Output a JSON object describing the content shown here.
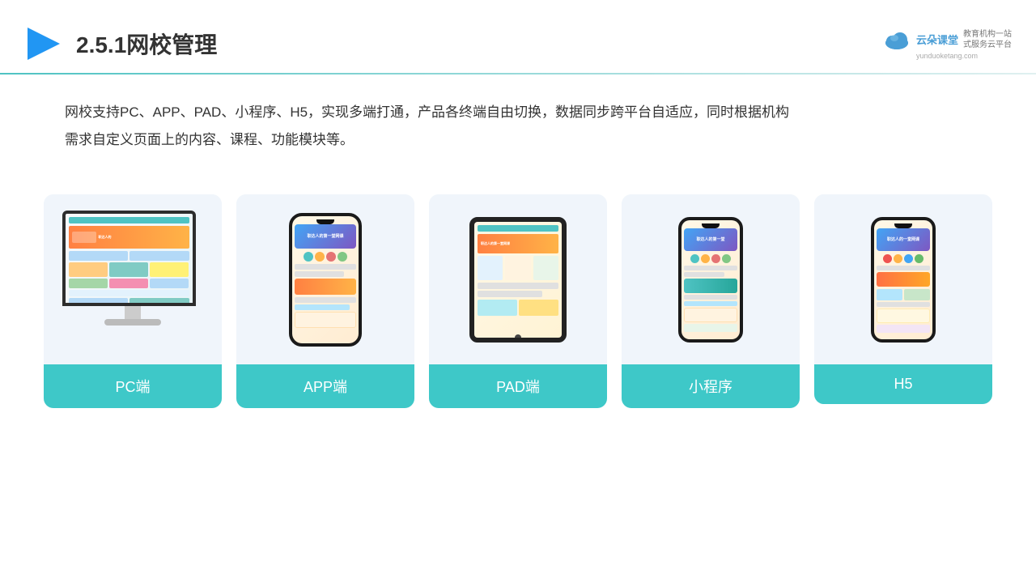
{
  "header": {
    "title": "2.5.1网校管理",
    "logo_text": "云朵课堂",
    "logo_subtitle": "教育机构一站\n式服务云平台",
    "logo_url": "yunduoketang.com"
  },
  "description": {
    "text": "网校支持PC、APP、PAD、小程序、H5，实现多端打通，产品各终端自由切换，数据同步跨平台自适应，同时根据机构\n需求自定义页面上的内容、课程、功能模块等。"
  },
  "cards": [
    {
      "id": "pc",
      "label": "PC端"
    },
    {
      "id": "app",
      "label": "APP端"
    },
    {
      "id": "pad",
      "label": "PAD端"
    },
    {
      "id": "miniprogram",
      "label": "小程序"
    },
    {
      "id": "h5",
      "label": "H5"
    }
  ],
  "accent_color": "#3ec8c8"
}
